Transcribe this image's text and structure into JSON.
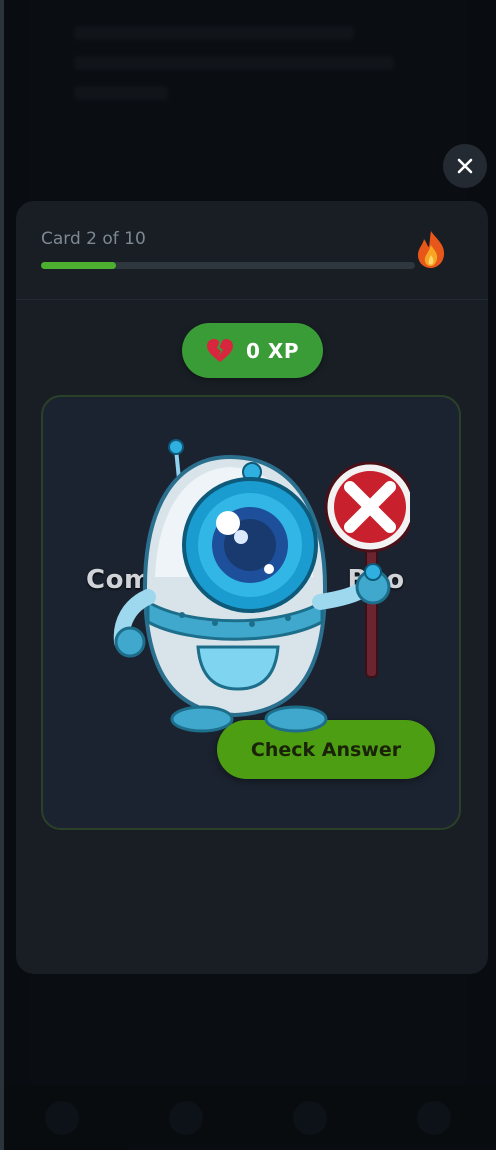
{
  "modal": {
    "card_counter": "Card 2 of 10",
    "progress": 0.2,
    "xp_label": "0 XP",
    "question_partial": "Com",
    "question_partial_end": "Boo",
    "check_answer_label": "Check Answer"
  },
  "colors": {
    "accent_green": "#3a9c37",
    "button_green": "#4e9e14",
    "progress_green": "#4caf2f"
  },
  "icons": {
    "close": "close-icon",
    "flame": "flame-icon",
    "xp": "broken-heart-icon",
    "mascot": "robot-mascot"
  }
}
